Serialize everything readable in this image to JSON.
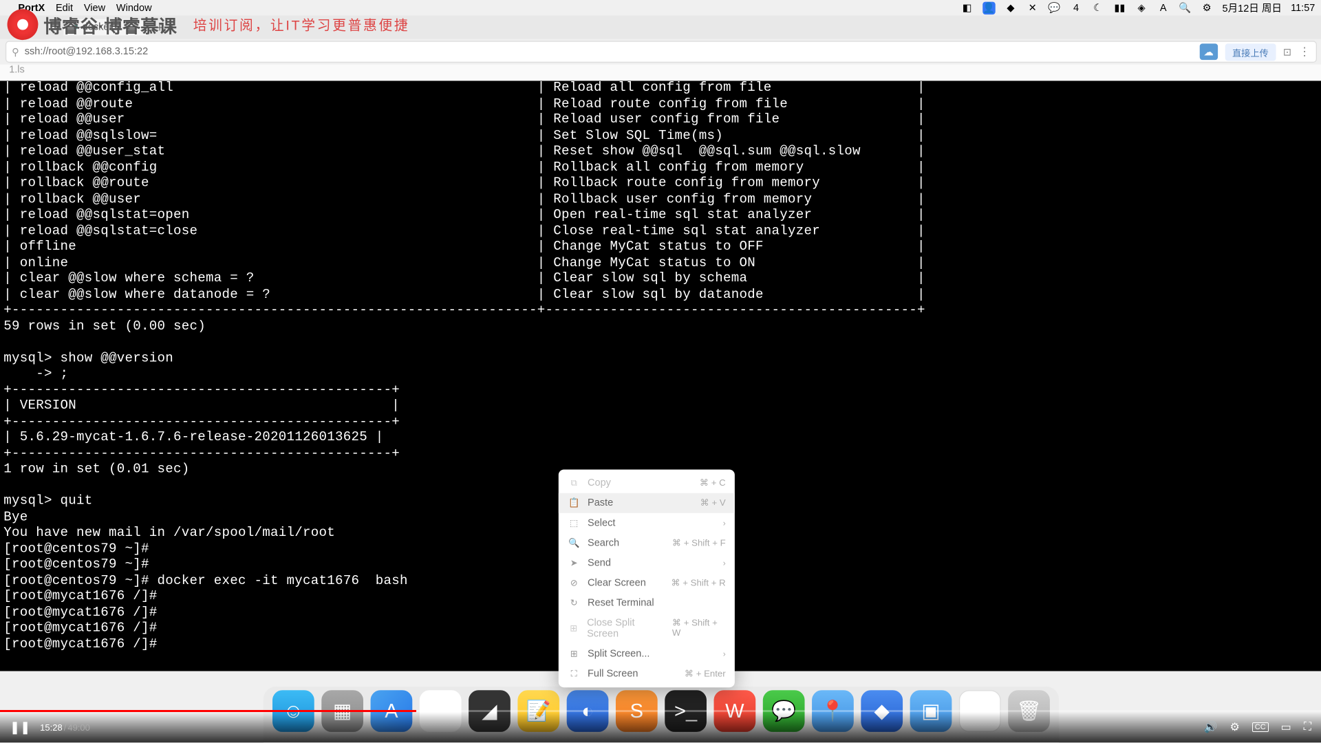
{
  "watermark": {
    "text": "博睿谷·博睿慕课",
    "tagline": "培训订阅，让IT学习更普惠便捷"
  },
  "menubar": {
    "app": "PortX",
    "items": [
      "Edit",
      "View",
      "Window"
    ],
    "badge": "4",
    "date": "5月12日 周日",
    "time": "11:57"
  },
  "tab": {
    "label": "docker"
  },
  "address": "ssh://root@192.168.3.15:22",
  "upload": "直接上传",
  "pathbar": "1.ls",
  "terminal_lines": [
    "| reload @@config_all                                             | Reload all config from file                  |",
    "| reload @@route                                                  | Reload route config from file                |",
    "| reload @@user                                                   | Reload user config from file                 |",
    "| reload @@sqlslow=                                               | Set Slow SQL Time(ms)                        |",
    "| reload @@user_stat                                              | Reset show @@sql  @@sql.sum @@sql.slow       |",
    "| rollback @@config                                               | Rollback all config from memory              |",
    "| rollback @@route                                                | Rollback route config from memory            |",
    "| rollback @@user                                                 | Rollback user config from memory             |",
    "| reload @@sqlstat=open                                           | Open real-time sql stat analyzer             |",
    "| reload @@sqlstat=close                                          | Close real-time sql stat analyzer            |",
    "| offline                                                         | Change MyCat status to OFF                   |",
    "| online                                                          | Change MyCat status to ON                    |",
    "| clear @@slow where schema = ?                                   | Clear slow sql by schema                     |",
    "| clear @@slow where datanode = ?                                 | Clear slow sql by datanode                   |",
    "+-----------------------------------------------------------------+----------------------------------------------+",
    "59 rows in set (0.00 sec)",
    "",
    "mysql> show @@version",
    "    -> ;",
    "+-----------------------------------------------+",
    "| VERSION                                       |",
    "+-----------------------------------------------+",
    "| 5.6.29-mycat-1.6.7.6-release-20201126013625 |",
    "+-----------------------------------------------+",
    "1 row in set (0.01 sec)",
    "",
    "mysql> quit",
    "Bye",
    "You have new mail in /var/spool/mail/root",
    "[root@centos79 ~]#",
    "[root@centos79 ~]#",
    "[root@centos79 ~]# docker exec -it mycat1676  bash",
    "[root@mycat1676 /]#",
    "[root@mycat1676 /]#",
    "[root@mycat1676 /]#",
    "[root@mycat1676 /]# "
  ],
  "context_menu": {
    "items": [
      {
        "icon": "⧉",
        "label": "Copy",
        "shortcut": "⌘ + C",
        "disabled": true
      },
      {
        "icon": "📋",
        "label": "Paste",
        "shortcut": "⌘ + V",
        "hover": true
      },
      {
        "icon": "⬚",
        "label": "Select",
        "arrow": true
      },
      {
        "icon": "🔍",
        "label": "Search",
        "shortcut": "⌘ + Shift + F"
      },
      {
        "icon": "➤",
        "label": "Send",
        "arrow": true
      },
      {
        "icon": "⊘",
        "label": "Clear Screen",
        "shortcut": "⌘ + Shift + R"
      },
      {
        "icon": "↻",
        "label": "Reset Terminal"
      },
      {
        "icon": "⊞",
        "label": "Close Split Screen",
        "shortcut": "⌘ + Shift + W",
        "disabled": true
      },
      {
        "icon": "⊞",
        "label": "Split Screen...",
        "arrow": true
      },
      {
        "icon": "⛶",
        "label": "Full Screen",
        "shortcut": "⌘ + Enter"
      }
    ]
  },
  "player": {
    "current": "15:28",
    "duration": "49:00",
    "cc": "CC"
  }
}
